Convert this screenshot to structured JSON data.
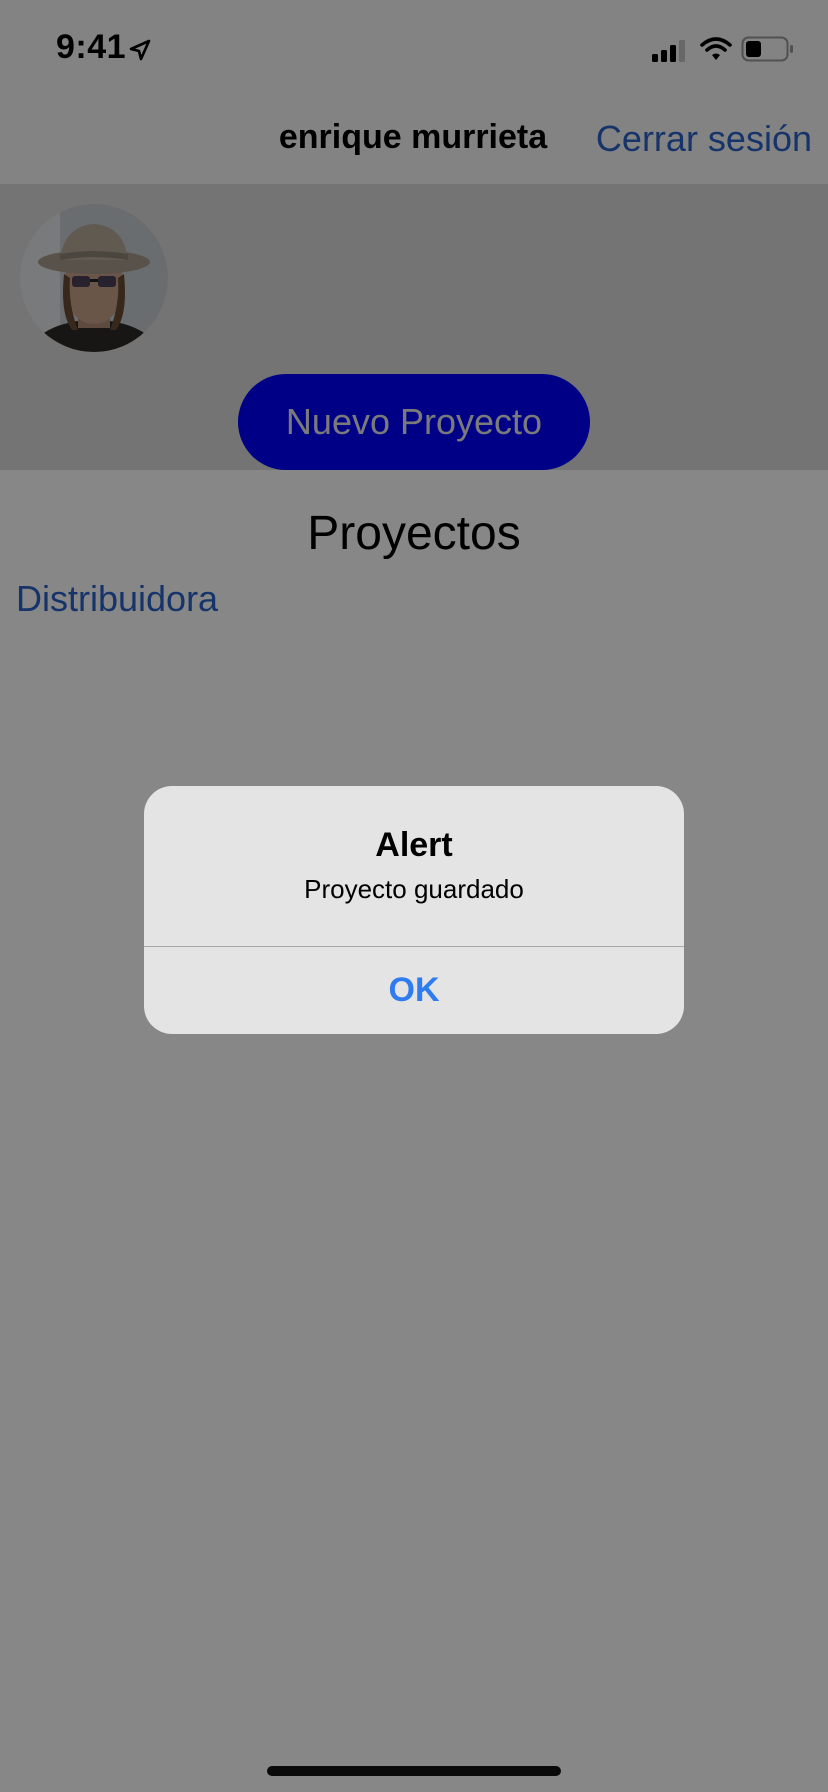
{
  "status_bar": {
    "time": "9:41",
    "icons": [
      "location-arrow-icon",
      "cellular-signal-icon",
      "wifi-icon",
      "battery-icon"
    ]
  },
  "nav": {
    "title": "enrique murrieta",
    "logout_label": "Cerrar sesión"
  },
  "profile": {
    "avatar": "user-avatar-photo",
    "new_project_label": "Nuevo Proyecto"
  },
  "projects": {
    "title": "Proyectos",
    "items": [
      "Distribuidora"
    ]
  },
  "alert": {
    "title": "Alert",
    "message": "Proyecto guardado",
    "ok_label": "OK"
  },
  "colors": {
    "link_blue": "#2a62c9",
    "button_blue": "#0000fe",
    "alert_action_blue": "#2f7bf0",
    "dim_overlay": "rgba(0,0,0,0.47)"
  }
}
